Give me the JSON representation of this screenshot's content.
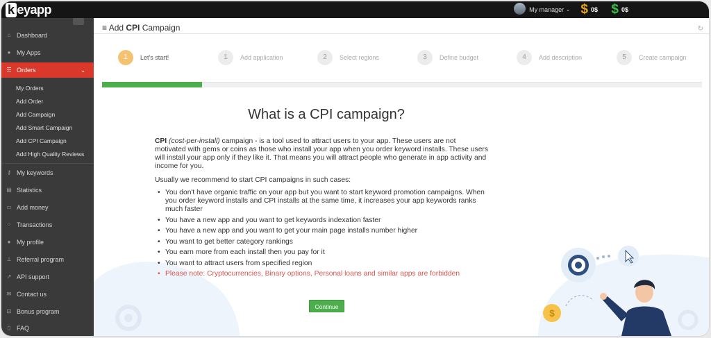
{
  "app": {
    "logo": "keyapp",
    "logo_k": "k",
    "logo_rest": "eyapp"
  },
  "topbar": {
    "manager_label": "My manager",
    "balance1": "0$",
    "balance2": "0$",
    "balance1_color": "#e7a51a",
    "balance2_color": "#3bbf4a"
  },
  "sidebar": {
    "items": [
      {
        "label": "Dashboard",
        "icon": "home-icon"
      },
      {
        "label": "My Apps",
        "icon": "apps-icon"
      },
      {
        "label": "Orders",
        "icon": "list-icon",
        "active": true
      },
      {
        "label": "My keywords",
        "icon": "key-icon"
      },
      {
        "label": "Statistics",
        "icon": "chart-icon"
      },
      {
        "label": "Add money",
        "icon": "money-icon"
      },
      {
        "label": "Transactions",
        "icon": "spinner-icon"
      },
      {
        "label": "My profile",
        "icon": "user-icon"
      },
      {
        "label": "Referral program",
        "icon": "sitemap-icon"
      },
      {
        "label": "API support",
        "icon": "external-link-icon"
      },
      {
        "label": "Contact us",
        "icon": "envelope-icon"
      },
      {
        "label": "Bonus program",
        "icon": "gift-icon"
      },
      {
        "label": "FAQ",
        "icon": "book-icon"
      }
    ],
    "orders_sub": [
      "My Orders",
      "Add Order",
      "Add Campaign",
      "Add Smart Campaign",
      "Add CPI Campaign",
      "Add High Quality Reviews"
    ],
    "active_color": "#d9382a"
  },
  "page": {
    "title_prefix": "Add ",
    "title_bold": "CPI",
    "title_suffix": " Campaign"
  },
  "steps": [
    {
      "num": "1",
      "label": "Let's start!",
      "current": true
    },
    {
      "num": "1",
      "label": "Add application"
    },
    {
      "num": "2",
      "label": "Select regions"
    },
    {
      "num": "3",
      "label": "Define budget"
    },
    {
      "num": "4",
      "label": "Add description"
    },
    {
      "num": "5",
      "label": "Create campaign"
    }
  ],
  "progress": {
    "fraction": 0.167,
    "color": "#4cae4c"
  },
  "content": {
    "heading": "What is a CPI campaign?",
    "intro_bold": "CPI",
    "intro_italic": "(cost-per-install)",
    "intro_rest": " campaign - is a tool used to attract users to your app. These users are not motivated with gems or coins as those who install your app when you order keyword installs. These users will install your app only if they like it. That means you will attract people who generate in app activity and income for you.",
    "recommend": "Usually we recommend to start CPI campaigns in such cases:",
    "bullets": [
      "You don't have organic traffic on your app but you want to start keyword promotion campaigns. When you order keyword installs and CPI installs at the same time, it increases your app keywords ranks much faster",
      "You have a new app and you want to get keywords indexation faster",
      "You have a new app and you want to get your main page installs number higher",
      "You want to get better category rankings",
      "You earn more from each install then you pay for it",
      "You want to attract users from specified region"
    ],
    "warning": "Please note: Cryptocurrencies, Binary options, Personal loans and similar apps are forbidden",
    "warning_color": "#d9534f"
  },
  "buttons": {
    "continue": "Continue"
  }
}
